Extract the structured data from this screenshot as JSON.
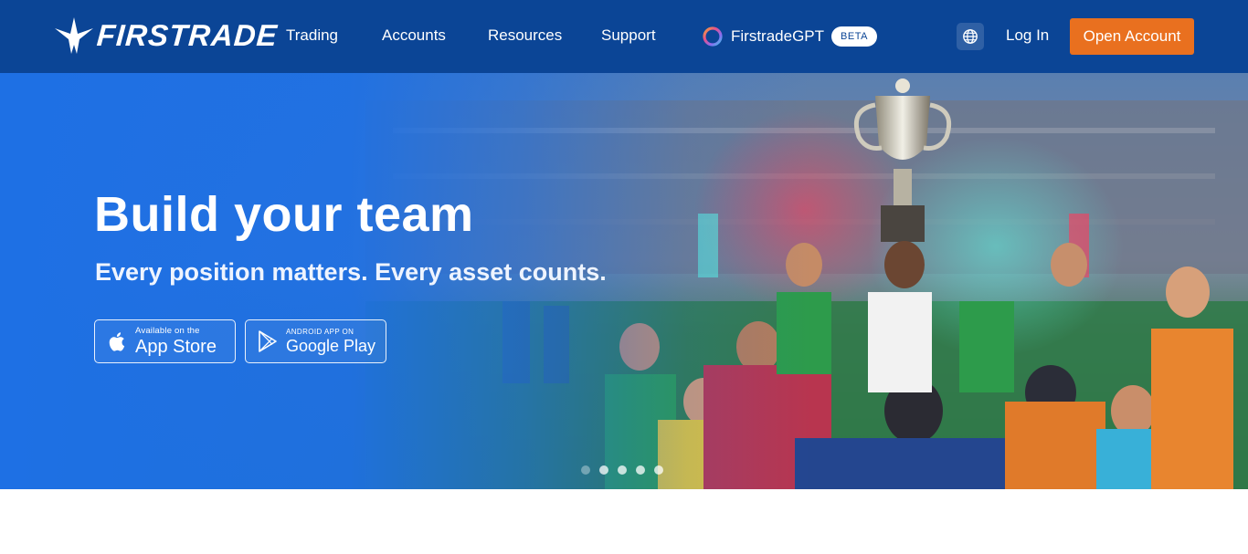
{
  "header": {
    "logo_text": "FIRSTRADE",
    "nav": [
      "Trading",
      "Accounts",
      "Resources",
      "Support"
    ],
    "gpt_label": "FirstradeGPT",
    "beta_badge": "BETA",
    "globe_icon": "globe-icon",
    "login": "Log In",
    "open_account": "Open Account"
  },
  "hero": {
    "title": "Build your team",
    "subtitle": "Every position matters. Every asset counts.",
    "app_store": {
      "small": "Available on the",
      "big": "App Store"
    },
    "google_play": {
      "small": "ANDROID APP ON",
      "big": "Google Play"
    },
    "slide_count": 5,
    "active_slide": 1
  },
  "colors": {
    "header_bg": "#0b4596",
    "hero_blue": "#1e6fe0",
    "cta_orange": "#e9701f"
  }
}
